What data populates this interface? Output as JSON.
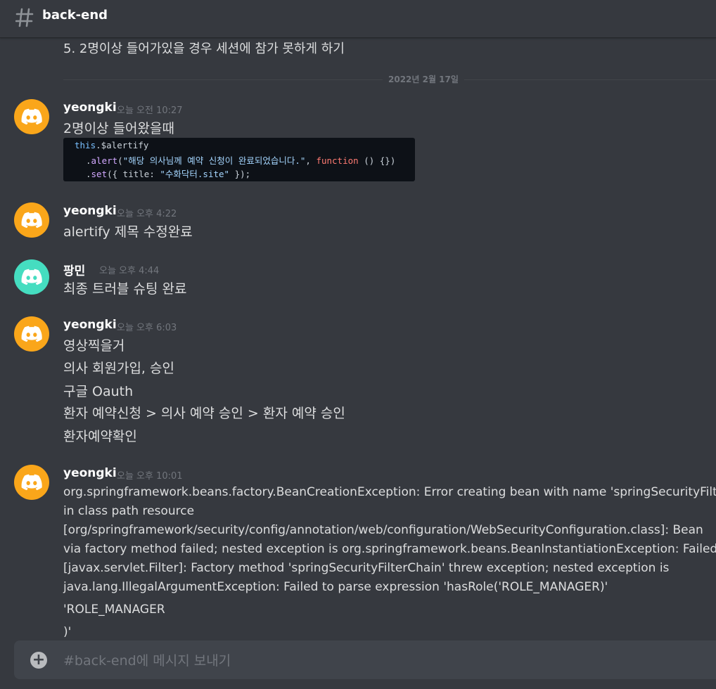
{
  "channel": {
    "name": "back-end"
  },
  "previous_line": "5. 2명이상 들어가있을 경우 세션에 참가 못하게 하기",
  "date_divider": "2022년 2월 17일",
  "colors": {
    "avatar_orange": "#faa61a",
    "avatar_teal": "#45ddc0",
    "background": "#36393f",
    "composer": "#40444b"
  },
  "messages": [
    {
      "author": "yeongki",
      "timestamp": "오늘 오전 10:27",
      "lines": [
        "2명이상 들어왔을때"
      ],
      "attachment": {
        "type": "code-screenshot",
        "code_lines": [
          "this.$alertify",
          ".alert(\"해당 의사님께 예약 신청이 완료되었습니다.\", function () {})",
          ".set({ title: \"수화닥터.site\" });"
        ]
      }
    },
    {
      "author": "yeongki",
      "timestamp": "오늘 오후 4:22",
      "lines": [
        "alertify 제목 수정완료"
      ]
    },
    {
      "author": "팡민",
      "timestamp": "오늘 오후 4:44",
      "lines": [
        "최종 트러블 슈팅 완료"
      ]
    },
    {
      "author": "yeongki",
      "timestamp": "오늘 오후 6:03",
      "lines": [
        "영상찍을거",
        "의사 회원가입, 승인",
        "구글 Oauth",
        "환자 예약신청 > 의사 예약 승인 > 환자 예약 승인",
        "환자예약확인"
      ]
    },
    {
      "author": "yeongki",
      "timestamp": "오늘 오후 10:01",
      "lines": [
        "org.springframework.beans.factory.BeanCreationException: Error creating bean with name 'springSecurityFilterC",
        "in class path resource",
        "[org/springframework/security/config/annotation/web/configuration/WebSecurityConfiguration.class]: Bean",
        "via factory method failed; nested exception is org.springframework.beans.BeanInstantiationException: Failed to i",
        "[javax.servlet.Filter]: Factory method 'springSecurityFilterChain' threw exception; nested exception is",
        "java.lang.IllegalArgumentException: Failed to parse expression 'hasRole('ROLE_MANAGER)'",
        "'ROLE_MANAGER",
        ")'"
      ]
    }
  ],
  "composer": {
    "placeholder": "#back-end에 메시지 보내기"
  },
  "icons": {
    "channel": "hash-icon",
    "avatar": "discord-logo-icon",
    "add": "plus-circle-icon"
  }
}
